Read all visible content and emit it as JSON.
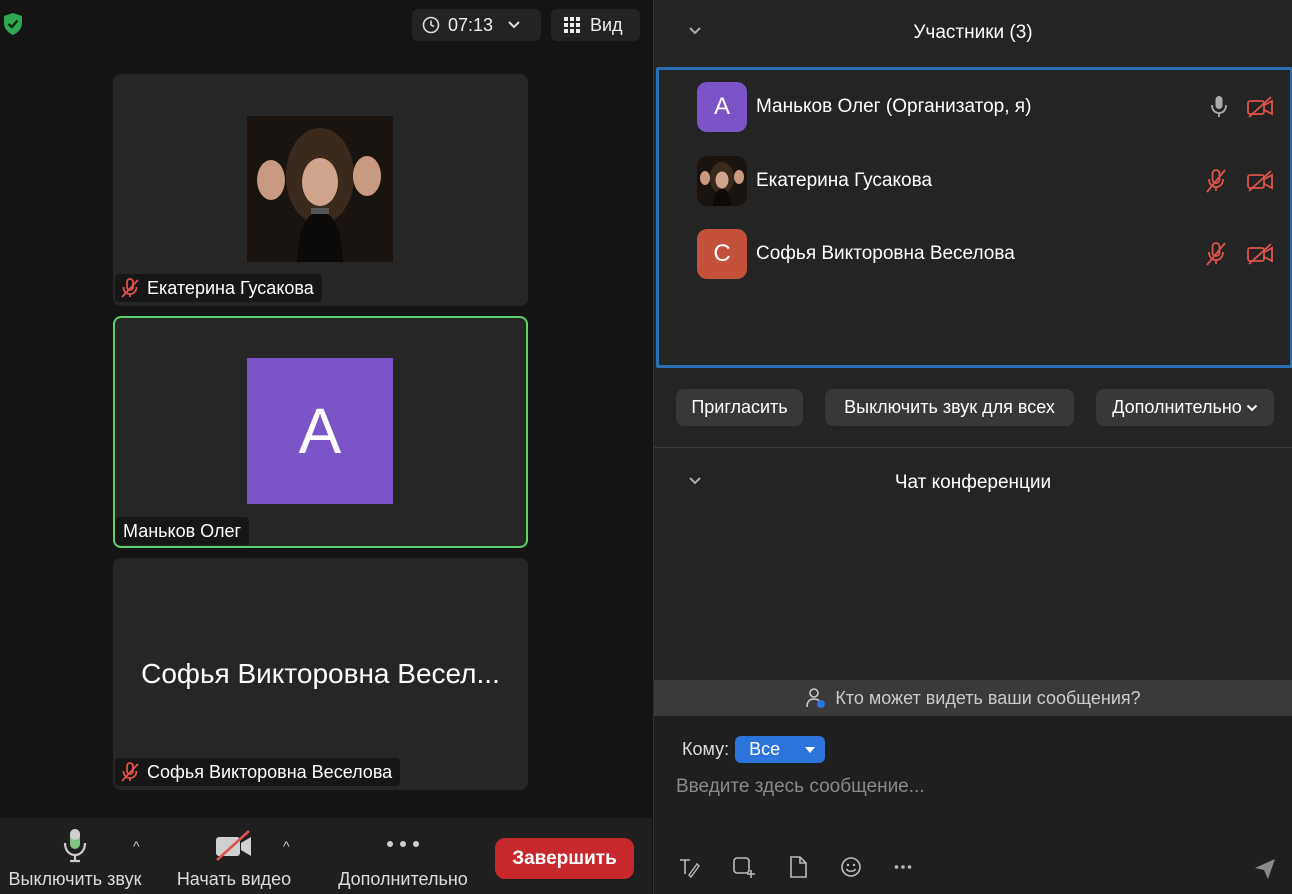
{
  "topbar": {
    "timer": "07:13",
    "view_label": "Вид"
  },
  "tiles": [
    {
      "name": "Екатерина Гусакова"
    },
    {
      "name": "Маньков Олег",
      "avatar_letter": "A"
    },
    {
      "name": "Софья Викторовна Веселова",
      "big_name": "Софья Викторовна Весел..."
    }
  ],
  "toolbar": {
    "mute_label": "Выключить звук",
    "video_label": "Начать видео",
    "more_label": "Дополнительно",
    "end_label": "Завершить"
  },
  "participants": {
    "title": "Участники (3)",
    "list": [
      {
        "name": "Маньков Олег (Организатор, я)",
        "letter": "A",
        "color": "#7b55c7"
      },
      {
        "name": "Екатерина Гусакова"
      },
      {
        "name": "Софья Викторовна Веселова",
        "letter": "C",
        "color": "#c4513a"
      }
    ],
    "invite_label": "Пригласить",
    "mute_all_label": "Выключить звук для всех",
    "more_label": "Дополнительно"
  },
  "chat": {
    "title": "Чат конференции",
    "who_can_see": "Кто может видеть ваши сообщения?",
    "to_label": "Кому:",
    "to_value": "Все",
    "placeholder": "Введите здесь сообщение..."
  },
  "colors": {
    "active_border": "#5fd068",
    "end_button": "#c7282b",
    "select_blue": "#2d74da",
    "muted_red": "#e0534a"
  }
}
